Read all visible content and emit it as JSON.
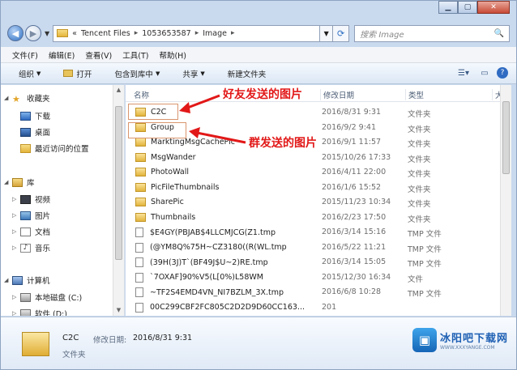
{
  "window": {
    "minimize": "▁",
    "maximize": "▢",
    "close": "✕"
  },
  "nav": {
    "back_icon": "◀",
    "forward_icon": "▶",
    "history_icon": "▼"
  },
  "address": {
    "crumbs": [
      "Tencent Files",
      "1053653587",
      "Image"
    ],
    "separator": "▸",
    "leading": "«"
  },
  "search": {
    "placeholder": "搜索 Image",
    "icon": "🔍"
  },
  "menu": [
    "文件(F)",
    "编辑(E)",
    "查看(V)",
    "工具(T)",
    "帮助(H)"
  ],
  "toolbar": {
    "organize": "组织",
    "open": "打开",
    "include_library": "包含到库中",
    "share": "共享",
    "new_folder": "新建文件夹"
  },
  "sidebar": {
    "favorites": "收藏夹",
    "downloads": "下载",
    "desktop": "桌面",
    "recent": "最近访问的位置",
    "libraries": "库",
    "videos": "视频",
    "pictures": "图片",
    "documents": "文档",
    "music": "音乐",
    "computer": "计算机",
    "local_disk_c": "本地磁盘 (C:)",
    "software_d": "软件 (D:)"
  },
  "columns": {
    "name": "名称",
    "date": "修改日期",
    "type": "类型",
    "size": "大"
  },
  "files": [
    {
      "name": "C2C",
      "date": "2016/8/31 9:31",
      "type": "文件夹",
      "kind": "folder"
    },
    {
      "name": "Group",
      "date": "2016/9/2 9:41",
      "type": "文件夹",
      "kind": "folder"
    },
    {
      "name": "MarktingMsgCachePic",
      "date": "2016/9/1 11:57",
      "type": "文件夹",
      "kind": "folder"
    },
    {
      "name": "MsgWander",
      "date": "2015/10/26 17:33",
      "type": "文件夹",
      "kind": "folder"
    },
    {
      "name": "PhotoWall",
      "date": "2016/4/11 22:00",
      "type": "文件夹",
      "kind": "folder"
    },
    {
      "name": "PicFileThumbnails",
      "date": "2016/1/6 15:52",
      "type": "文件夹",
      "kind": "folder"
    },
    {
      "name": "SharePic",
      "date": "2015/11/23 10:34",
      "type": "文件夹",
      "kind": "folder"
    },
    {
      "name": "Thumbnails",
      "date": "2016/2/23 17:50",
      "type": "文件夹",
      "kind": "folder"
    },
    {
      "name": "$E4GY(PBJAB$4LLCMJCG(Z1.tmp",
      "date": "2016/3/14 15:16",
      "type": "TMP 文件",
      "kind": "file"
    },
    {
      "name": "(@YM8Q%75H~CZ3180((R(WL.tmp",
      "date": "2016/5/22 11:21",
      "type": "TMP 文件",
      "kind": "file"
    },
    {
      "name": "(39H(3J)T`(BF49J$U~2)RE.tmp",
      "date": "2016/3/14 15:05",
      "type": "TMP 文件",
      "kind": "file"
    },
    {
      "name": "`7OXAF]90%V5(L[0%)L58WM",
      "date": "2015/12/30 16:34",
      "type": "文件",
      "kind": "file"
    },
    {
      "name": "~TF2S4EMD4VN_NI7BZLM_3X.tmp",
      "date": "2016/6/8 10:28",
      "type": "TMP 文件",
      "kind": "file"
    },
    {
      "name": "00C299CBF2FC805C2D2D9D60CC163...",
      "date": "201",
      "type": "",
      "kind": "file"
    }
  ],
  "annotations": {
    "friend": "好友发送的图片",
    "group": "群发送的图片",
    "color": "#e21818"
  },
  "details": {
    "name": "C2C",
    "modified_label": "修改日期:",
    "modified": "2016/8/31 9:31",
    "type": "文件夹"
  },
  "watermark": {
    "title": "冰阳吧下载网",
    "sub": "WWW.XXXYANGE.COM",
    "logo": "▣"
  }
}
